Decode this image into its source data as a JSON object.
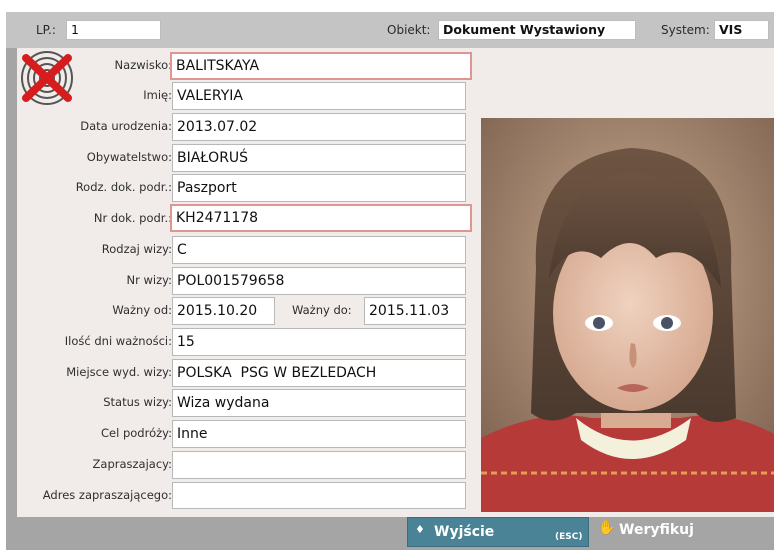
{
  "header": {
    "lp_label": "LP.:",
    "lp_value": "1",
    "obiekt_label": "Obiekt:",
    "obiekt_value": "Dokument Wystawiony",
    "system_label": "System:",
    "system_value": "VIS"
  },
  "fields": {
    "nazwisko": {
      "label": "Nazwisko:",
      "value": "BALITSKAYA"
    },
    "imie": {
      "label": "Imię:",
      "value": "VALERYIA"
    },
    "data_urodzenia": {
      "label": "Data urodzenia:",
      "value": "2013.07.02"
    },
    "obywatelstwo": {
      "label": "Obywatelstwo:",
      "value": "BIAŁORUŚ"
    },
    "rodz_dok": {
      "label": "Rodz. dok. podr.:",
      "value": "Paszport"
    },
    "nr_dok": {
      "label": "Nr dok. podr.:",
      "value": "KH2471178"
    },
    "rodzaj_wizy": {
      "label": "Rodzaj wizy:",
      "value": "C"
    },
    "nr_wizy": {
      "label": "Nr wizy:",
      "value": "POL001579658"
    },
    "wazny_od": {
      "label": "Ważny od:",
      "value": "2015.10.20"
    },
    "wazny_do": {
      "label": "Ważny do:",
      "value": "2015.11.03"
    },
    "ilosc_dni": {
      "label": "Ilość dni ważności:",
      "value": "15"
    },
    "miejsce_wyd": {
      "label": "Miejsce wyd. wizy:",
      "value": "POLSKA  PSG W BEZLEDACH"
    },
    "status_wizy": {
      "label": "Status wizy:",
      "value": "Wiza wydana"
    },
    "cel_podrozy": {
      "label": "Cel podróży:",
      "value": "Inne"
    },
    "zapraszajacy": {
      "label": "Zapraszajacy:",
      "value": ""
    },
    "adres_zapraszajacego": {
      "label": "Adres zapraszającego:",
      "value": ""
    }
  },
  "footer": {
    "exit_label": "Wyjście",
    "exit_hint": "(ESC)",
    "verify_label": "Weryfikuj"
  },
  "icons": {
    "no_fingerprint": "fingerprint-crossed-icon",
    "photo": "portrait-photo",
    "exit": "exit-icon",
    "verify": "hand-icon"
  },
  "colors": {
    "highlight_border": "#de9790",
    "exit_button": "#4a8296",
    "cross_red": "#d61c1c"
  }
}
